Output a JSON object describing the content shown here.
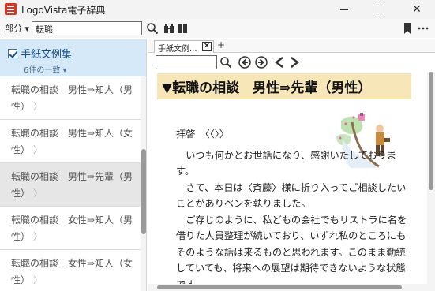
{
  "window": {
    "title": "LogoVista電子辞典",
    "minimize_glyph": "",
    "close_glyph": "✕"
  },
  "toolbar": {
    "part_label": "部分 ▾",
    "search_value": "転職",
    "icons": [
      "search-icon",
      "binoculars-icon",
      "books-icon",
      "bookmark-icon",
      "more-icon"
    ]
  },
  "left_panel": {
    "header_title": "手紙文例集",
    "header_count": "6件の一致 ▾",
    "results": [
      {
        "text": "転職の相談　男性⇒知人（男性）",
        "mark": "〉"
      },
      {
        "text": "転職の相談　男性⇒知人（女性）",
        "mark": "〉"
      },
      {
        "text": "転職の相談　男性⇒先輩（男性）",
        "mark": "〉"
      },
      {
        "text": "転職の相談　女性⇒知人（男性）",
        "mark": "〉"
      },
      {
        "text": "転職の相談　女性⇒知人（女性）",
        "mark": "〉"
      }
    ]
  },
  "tabs": {
    "active_label": "手紙文例...",
    "close_glyph": "✕",
    "add_glyph": "+"
  },
  "document": {
    "title": "▼転職の相談　男性⇒先輩（男性）",
    "greeting": "拝啓　〈〈〉〉",
    "paragraphs": [
      "いつも何かとお世話になり、感謝いたしております。",
      "さて、本日は〈斉藤〉様に折り入ってご相談したいことがありペンを執りました。",
      "ご存じのように、私どもの会社でもリストラに名を借りた人員整理が続いており、いずれ私のところにもそのような話は来るものと思われます。このまま勤続していても、将来への展望は期待できないような状態です。"
    ]
  },
  "colors": {
    "accent": "#d6e9f8",
    "title_band": "#f7e6b7",
    "app_icon": "#e0301e"
  }
}
